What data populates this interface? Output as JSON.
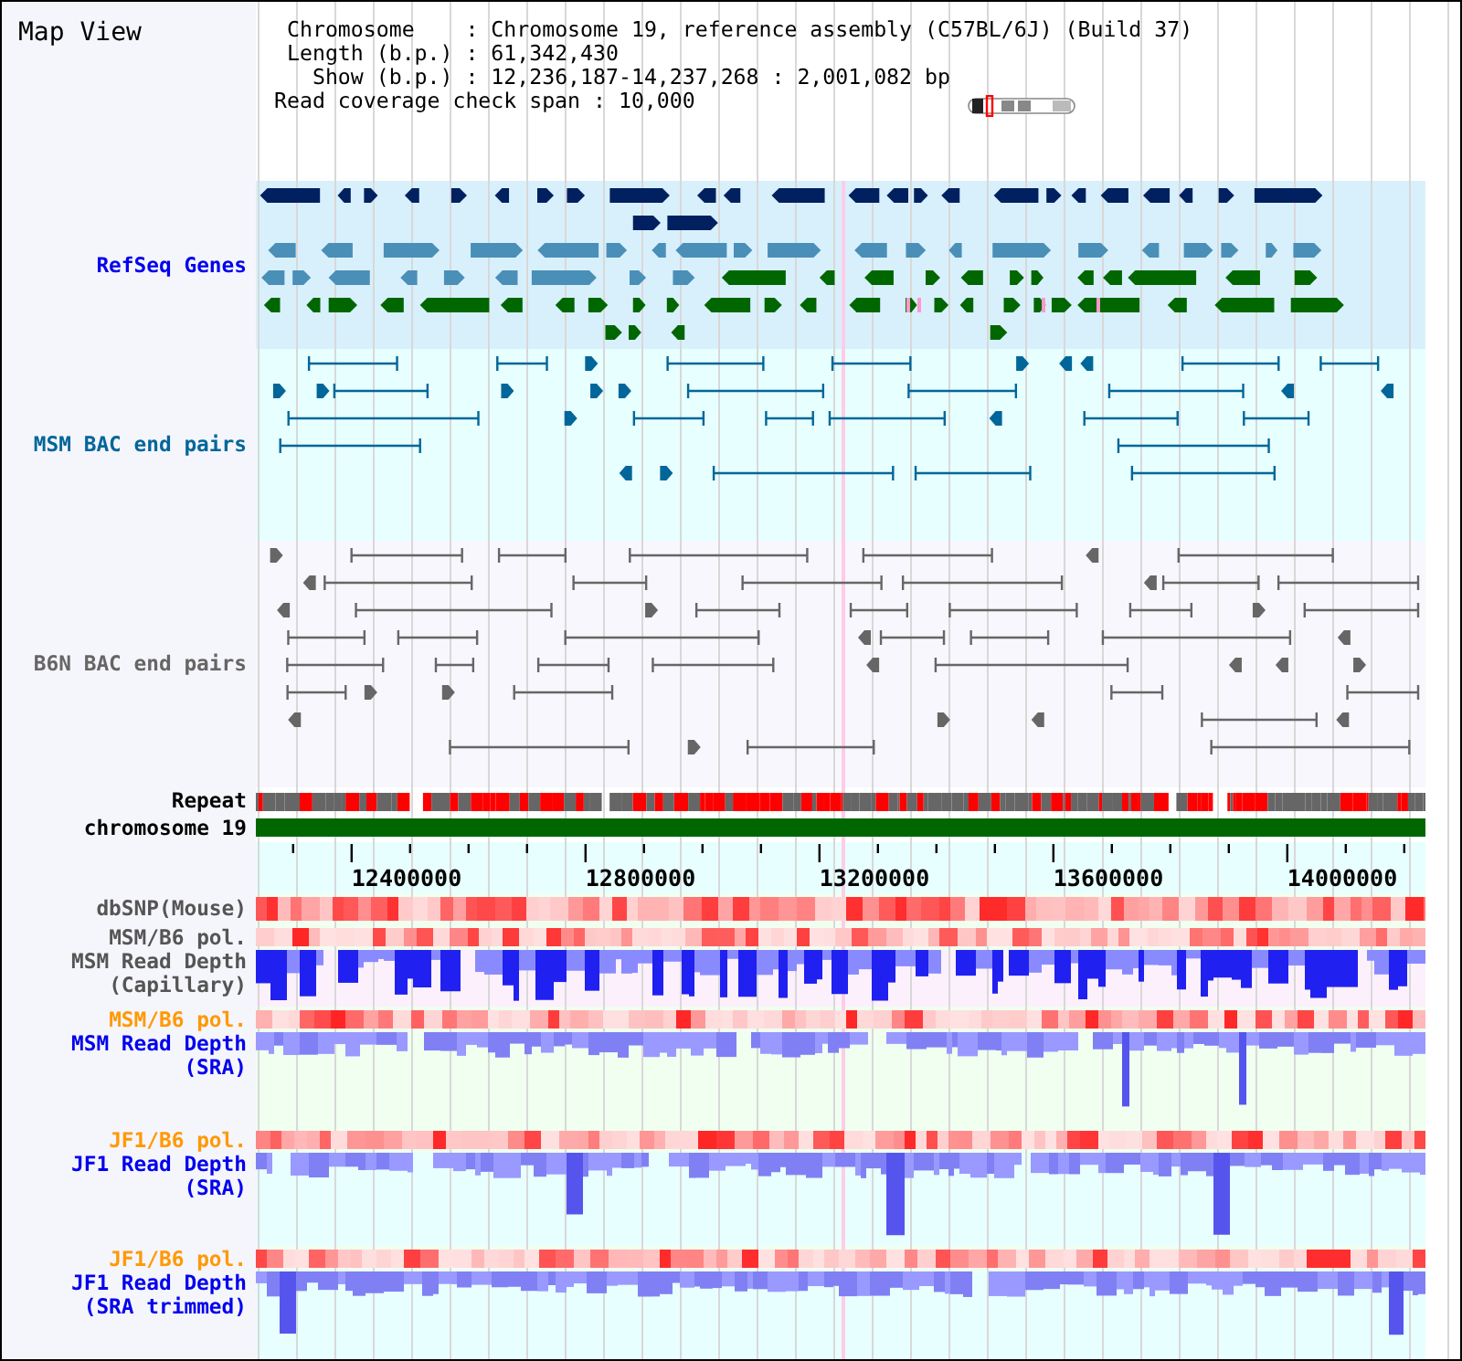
{
  "title": "Map View",
  "info": [
    {
      "kind": "field",
      "text": "Chromosome    : Chromosome 19, reference assembly (C57BL/6J) (Build 37)"
    },
    {
      "kind": "field",
      "text": "Length (b.p.) : 61,342,430"
    },
    {
      "kind": "field",
      "text": "  Show (b.p.) : 12,236,187-14,237,268 : 2,001,082 bp"
    },
    {
      "kind": "summary",
      "text": "Read coverage check span : 10,000"
    }
  ],
  "tracks": [
    {
      "kind": "genes",
      "label": [
        "RefSeq Genes"
      ],
      "color": "#0000ee"
    },
    {
      "kind": "bac",
      "label": [
        "MSM BAC end pairs"
      ],
      "color": "#006699"
    },
    {
      "kind": "bac",
      "label": [
        "B6N BAC end pairs"
      ],
      "color": "#666666"
    },
    {
      "kind": "repeat",
      "label": [
        "Repeat"
      ],
      "color": "#000000"
    },
    {
      "kind": "chromosome",
      "label": [
        "chromosome 19"
      ],
      "color": "#000000"
    },
    {
      "kind": "axis",
      "ticks": [
        "12400000",
        "12800000",
        "13200000",
        "13600000",
        "14000000"
      ]
    },
    {
      "kind": "heat",
      "label": [
        "dbSNP(Mouse)"
      ],
      "color": "#555555"
    },
    {
      "kind": "heat",
      "label": [
        "MSM/B6 pol."
      ],
      "color": "#555555"
    },
    {
      "kind": "depth",
      "label": [
        "MSM Read Depth",
        "(Capillary)"
      ],
      "color": "#555555"
    },
    {
      "kind": "heat",
      "label": [
        "MSM/B6 pol."
      ],
      "color": "#ff9900"
    },
    {
      "kind": "depth",
      "label": [
        "MSM Read Depth",
        "(SRA)"
      ],
      "color": "#0000ee"
    },
    {
      "kind": "heat",
      "label": [
        "JF1/B6 pol."
      ],
      "color": "#ff9900"
    },
    {
      "kind": "depth",
      "label": [
        "JF1 Read Depth",
        "(SRA)"
      ],
      "color": "#0000ee"
    },
    {
      "kind": "heat",
      "label": [
        "JF1/B6 pol."
      ],
      "color": "#ff9900"
    },
    {
      "kind": "depth",
      "label": [
        "JF1 Read Depth",
        "(SRA trimmed)"
      ],
      "color": "#0000ee"
    }
  ]
}
